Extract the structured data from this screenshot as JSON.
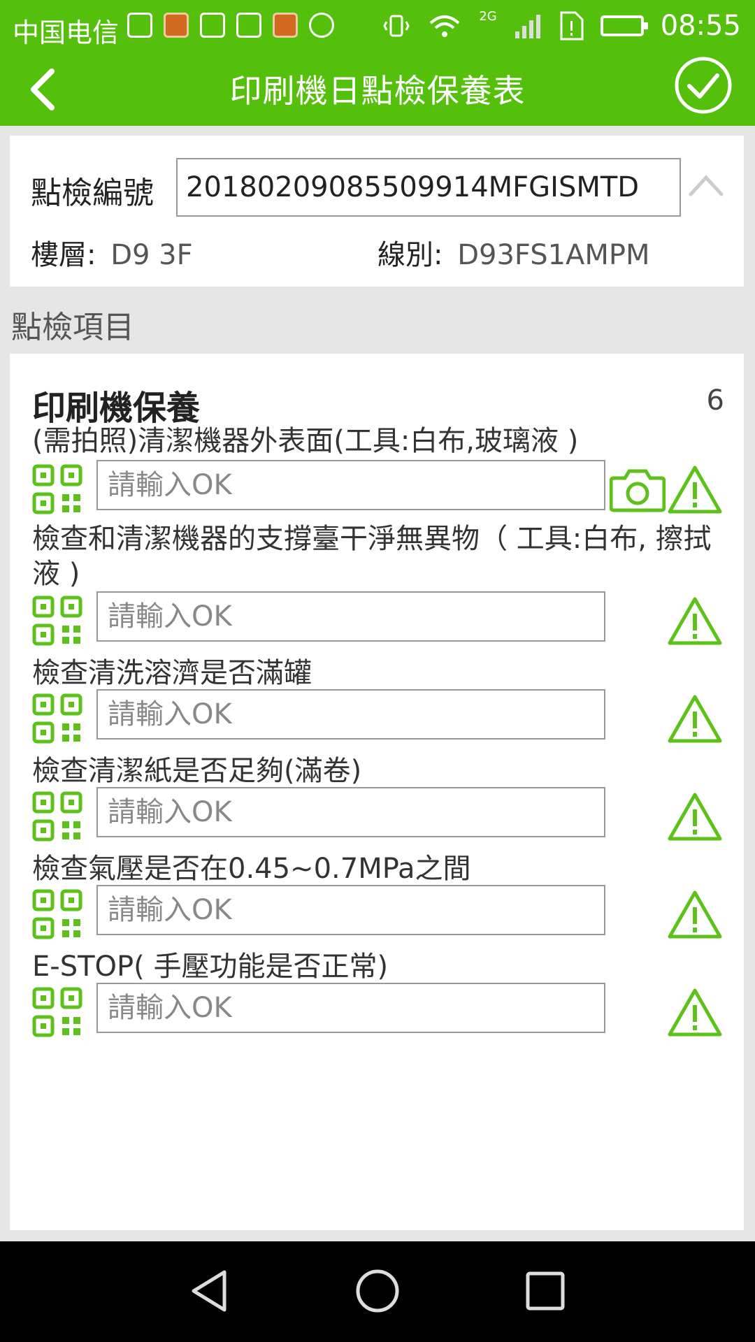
{
  "status": {
    "carrier": "中国电信",
    "network_badge": "2G",
    "time": "08:55"
  },
  "header": {
    "title": "印刷機日點檢保養表"
  },
  "record": {
    "no_label": "點檢編號",
    "no_value": "20180209085509914MFGISMTD",
    "floor_label": "樓層:",
    "floor_value": "D9 3F",
    "line_label": "線別:",
    "line_value": "D93FS1AMPM"
  },
  "section": {
    "title": "點檢項目"
  },
  "group": {
    "title": "印刷機保養",
    "count": "6"
  },
  "items": [
    {
      "label": "(需拍照)清潔機器外表面(工具:白布,玻璃液 )",
      "placeholder": "請輸入OK"
    },
    {
      "label": "檢查和清潔機器的支撐臺干淨無異物（ 工具:白布, 擦拭液 )",
      "placeholder": "請輸入OK"
    },
    {
      "label": "檢查清洗溶濟是否滿罐",
      "placeholder": "請輸入OK"
    },
    {
      "label": "檢查清潔紙是否足夠(滿卷)",
      "placeholder": "請輸入OK"
    },
    {
      "label": "檢查氣壓是否在0.45~0.7MPa之間",
      "placeholder": "請輸入OK"
    },
    {
      "label": "E-STOP( 手壓功能是否正常)",
      "placeholder": "請輸入OK"
    }
  ],
  "colors": {
    "accent": "#55c00b",
    "icon_green": "#5cc21a"
  },
  "icons": {
    "back": "chevron-left-icon",
    "confirm": "check-circle-icon",
    "collapse": "chevron-up-icon",
    "qr": "qr-code-icon",
    "camera": "camera-icon",
    "warning": "warning-icon"
  }
}
